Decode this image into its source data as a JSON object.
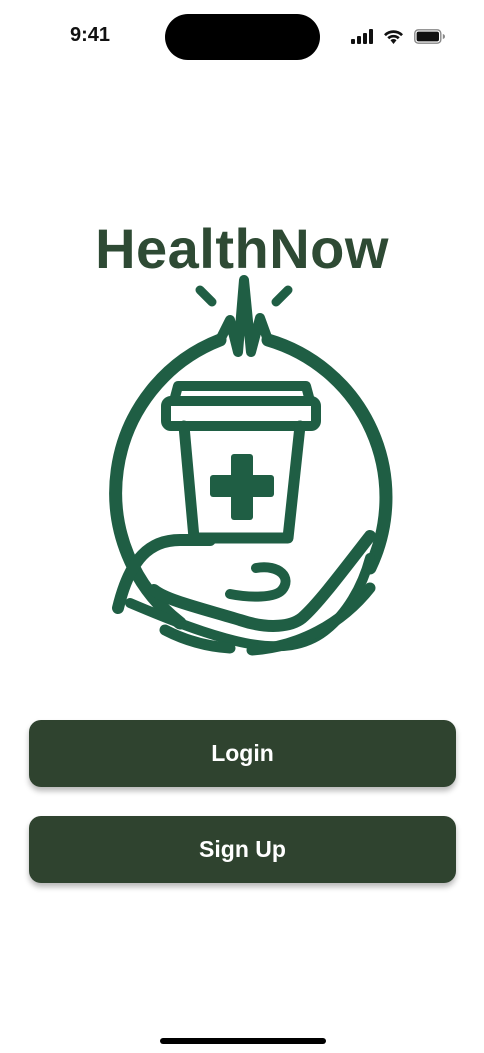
{
  "status_bar": {
    "time": "9:41",
    "icons": [
      "cellular-signal-icon",
      "wifi-icon",
      "battery-icon"
    ]
  },
  "app": {
    "title": "HealthNow",
    "logo_icon": "health-cup-hand-logo"
  },
  "actions": {
    "login_label": "Login",
    "signup_label": "Sign Up"
  },
  "colors": {
    "brand_dark": "#2f432f",
    "title_text": "#2e4a34",
    "logo_green": "#1f5e44",
    "button_text": "#ffffff",
    "background": "#ffffff"
  }
}
